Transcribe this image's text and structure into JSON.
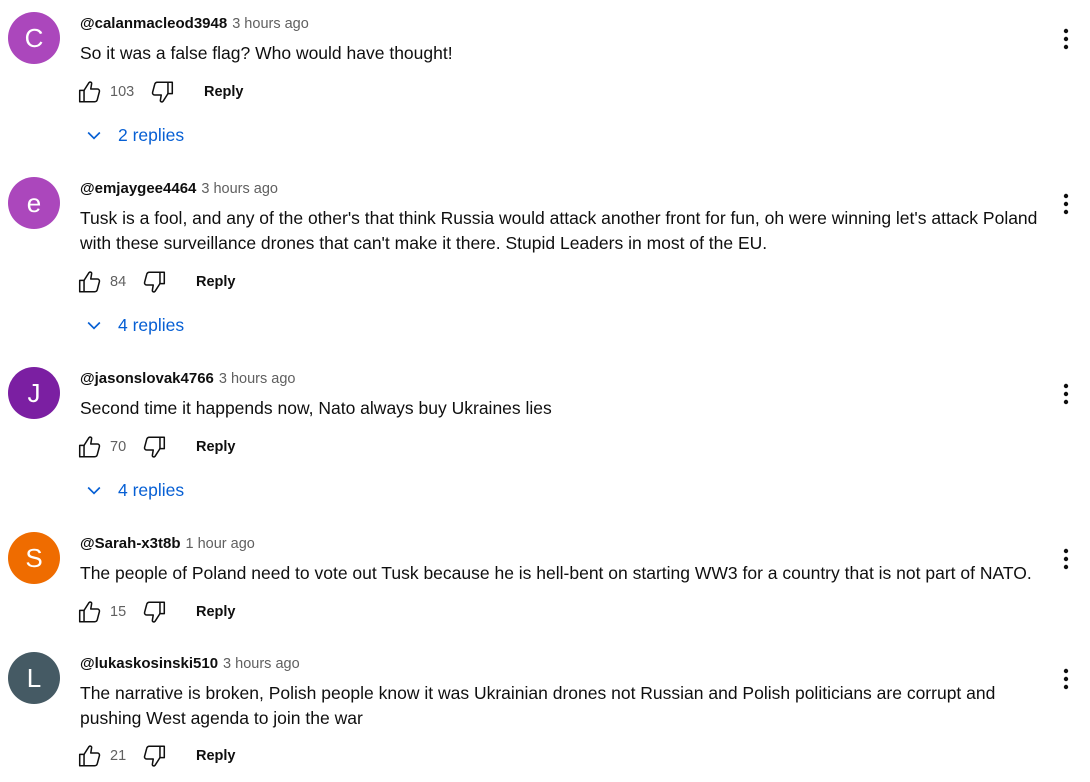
{
  "comments": [
    {
      "avatar_letter": "C",
      "avatar_color": "#ab47bc",
      "author": "@calanmacleod3948",
      "time": "3 hours ago",
      "text": "So it was a false flag? Who would have thought!",
      "likes": "103",
      "reply_label": "Reply",
      "replies_label": "2 replies"
    },
    {
      "avatar_letter": "e",
      "avatar_color": "#ab47bc",
      "author": "@emjaygee4464",
      "time": "3 hours ago",
      "text": "Tusk is a fool, and any of the other's that think Russia would attack another front for fun, oh were winning let's attack Poland with these surveillance drones that can't make it there. Stupid Leaders in most of the EU.",
      "likes": "84",
      "reply_label": "Reply",
      "replies_label": "4 replies"
    },
    {
      "avatar_letter": "J",
      "avatar_color": "#7b1fa2",
      "author": "@jasonslovak4766",
      "time": "3 hours ago",
      "text": "Second time it happends now, Nato always buy Ukraines lies",
      "likes": "70",
      "reply_label": "Reply",
      "replies_label": "4 replies"
    },
    {
      "avatar_letter": "S",
      "avatar_color": "#ef6c00",
      "author": "@Sarah-x3t8b",
      "time": "1 hour ago",
      "text": "The people of Poland need to vote out Tusk because he is hell-bent on starting WW3 for a country that is not part of NATO.",
      "likes": "15",
      "reply_label": "Reply"
    },
    {
      "avatar_letter": "L",
      "avatar_color": "#455a64",
      "author": "@lukaskosinski510",
      "time": "3 hours ago",
      "text": "The narrative is broken, Polish people know it was Ukrainian drones not Russian and Polish politicians are corrupt and pushing West agenda to join the war",
      "likes": "21",
      "reply_label": "Reply"
    }
  ],
  "icons": {
    "like": "thumbs-up-icon",
    "dislike": "thumbs-down-icon",
    "more": "more-vert-icon",
    "expand": "chevron-down-icon"
  },
  "colors": {
    "link": "#065fd4",
    "secondary_text": "#606060"
  }
}
